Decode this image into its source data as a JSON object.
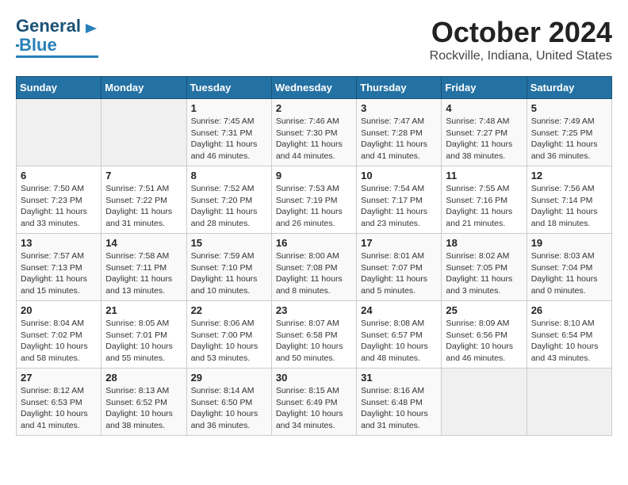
{
  "header": {
    "logo_general": "General",
    "logo_blue": "Blue",
    "month": "October 2024",
    "location": "Rockville, Indiana, United States"
  },
  "weekdays": [
    "Sunday",
    "Monday",
    "Tuesday",
    "Wednesday",
    "Thursday",
    "Friday",
    "Saturday"
  ],
  "weeks": [
    [
      {
        "day": "",
        "info": ""
      },
      {
        "day": "",
        "info": ""
      },
      {
        "day": "1",
        "info": "Sunrise: 7:45 AM\nSunset: 7:31 PM\nDaylight: 11 hours and 46 minutes."
      },
      {
        "day": "2",
        "info": "Sunrise: 7:46 AM\nSunset: 7:30 PM\nDaylight: 11 hours and 44 minutes."
      },
      {
        "day": "3",
        "info": "Sunrise: 7:47 AM\nSunset: 7:28 PM\nDaylight: 11 hours and 41 minutes."
      },
      {
        "day": "4",
        "info": "Sunrise: 7:48 AM\nSunset: 7:27 PM\nDaylight: 11 hours and 38 minutes."
      },
      {
        "day": "5",
        "info": "Sunrise: 7:49 AM\nSunset: 7:25 PM\nDaylight: 11 hours and 36 minutes."
      }
    ],
    [
      {
        "day": "6",
        "info": "Sunrise: 7:50 AM\nSunset: 7:23 PM\nDaylight: 11 hours and 33 minutes."
      },
      {
        "day": "7",
        "info": "Sunrise: 7:51 AM\nSunset: 7:22 PM\nDaylight: 11 hours and 31 minutes."
      },
      {
        "day": "8",
        "info": "Sunrise: 7:52 AM\nSunset: 7:20 PM\nDaylight: 11 hours and 28 minutes."
      },
      {
        "day": "9",
        "info": "Sunrise: 7:53 AM\nSunset: 7:19 PM\nDaylight: 11 hours and 26 minutes."
      },
      {
        "day": "10",
        "info": "Sunrise: 7:54 AM\nSunset: 7:17 PM\nDaylight: 11 hours and 23 minutes."
      },
      {
        "day": "11",
        "info": "Sunrise: 7:55 AM\nSunset: 7:16 PM\nDaylight: 11 hours and 21 minutes."
      },
      {
        "day": "12",
        "info": "Sunrise: 7:56 AM\nSunset: 7:14 PM\nDaylight: 11 hours and 18 minutes."
      }
    ],
    [
      {
        "day": "13",
        "info": "Sunrise: 7:57 AM\nSunset: 7:13 PM\nDaylight: 11 hours and 15 minutes."
      },
      {
        "day": "14",
        "info": "Sunrise: 7:58 AM\nSunset: 7:11 PM\nDaylight: 11 hours and 13 minutes."
      },
      {
        "day": "15",
        "info": "Sunrise: 7:59 AM\nSunset: 7:10 PM\nDaylight: 11 hours and 10 minutes."
      },
      {
        "day": "16",
        "info": "Sunrise: 8:00 AM\nSunset: 7:08 PM\nDaylight: 11 hours and 8 minutes."
      },
      {
        "day": "17",
        "info": "Sunrise: 8:01 AM\nSunset: 7:07 PM\nDaylight: 11 hours and 5 minutes."
      },
      {
        "day": "18",
        "info": "Sunrise: 8:02 AM\nSunset: 7:05 PM\nDaylight: 11 hours and 3 minutes."
      },
      {
        "day": "19",
        "info": "Sunrise: 8:03 AM\nSunset: 7:04 PM\nDaylight: 11 hours and 0 minutes."
      }
    ],
    [
      {
        "day": "20",
        "info": "Sunrise: 8:04 AM\nSunset: 7:02 PM\nDaylight: 10 hours and 58 minutes."
      },
      {
        "day": "21",
        "info": "Sunrise: 8:05 AM\nSunset: 7:01 PM\nDaylight: 10 hours and 55 minutes."
      },
      {
        "day": "22",
        "info": "Sunrise: 8:06 AM\nSunset: 7:00 PM\nDaylight: 10 hours and 53 minutes."
      },
      {
        "day": "23",
        "info": "Sunrise: 8:07 AM\nSunset: 6:58 PM\nDaylight: 10 hours and 50 minutes."
      },
      {
        "day": "24",
        "info": "Sunrise: 8:08 AM\nSunset: 6:57 PM\nDaylight: 10 hours and 48 minutes."
      },
      {
        "day": "25",
        "info": "Sunrise: 8:09 AM\nSunset: 6:56 PM\nDaylight: 10 hours and 46 minutes."
      },
      {
        "day": "26",
        "info": "Sunrise: 8:10 AM\nSunset: 6:54 PM\nDaylight: 10 hours and 43 minutes."
      }
    ],
    [
      {
        "day": "27",
        "info": "Sunrise: 8:12 AM\nSunset: 6:53 PM\nDaylight: 10 hours and 41 minutes."
      },
      {
        "day": "28",
        "info": "Sunrise: 8:13 AM\nSunset: 6:52 PM\nDaylight: 10 hours and 38 minutes."
      },
      {
        "day": "29",
        "info": "Sunrise: 8:14 AM\nSunset: 6:50 PM\nDaylight: 10 hours and 36 minutes."
      },
      {
        "day": "30",
        "info": "Sunrise: 8:15 AM\nSunset: 6:49 PM\nDaylight: 10 hours and 34 minutes."
      },
      {
        "day": "31",
        "info": "Sunrise: 8:16 AM\nSunset: 6:48 PM\nDaylight: 10 hours and 31 minutes."
      },
      {
        "day": "",
        "info": ""
      },
      {
        "day": "",
        "info": ""
      }
    ]
  ]
}
